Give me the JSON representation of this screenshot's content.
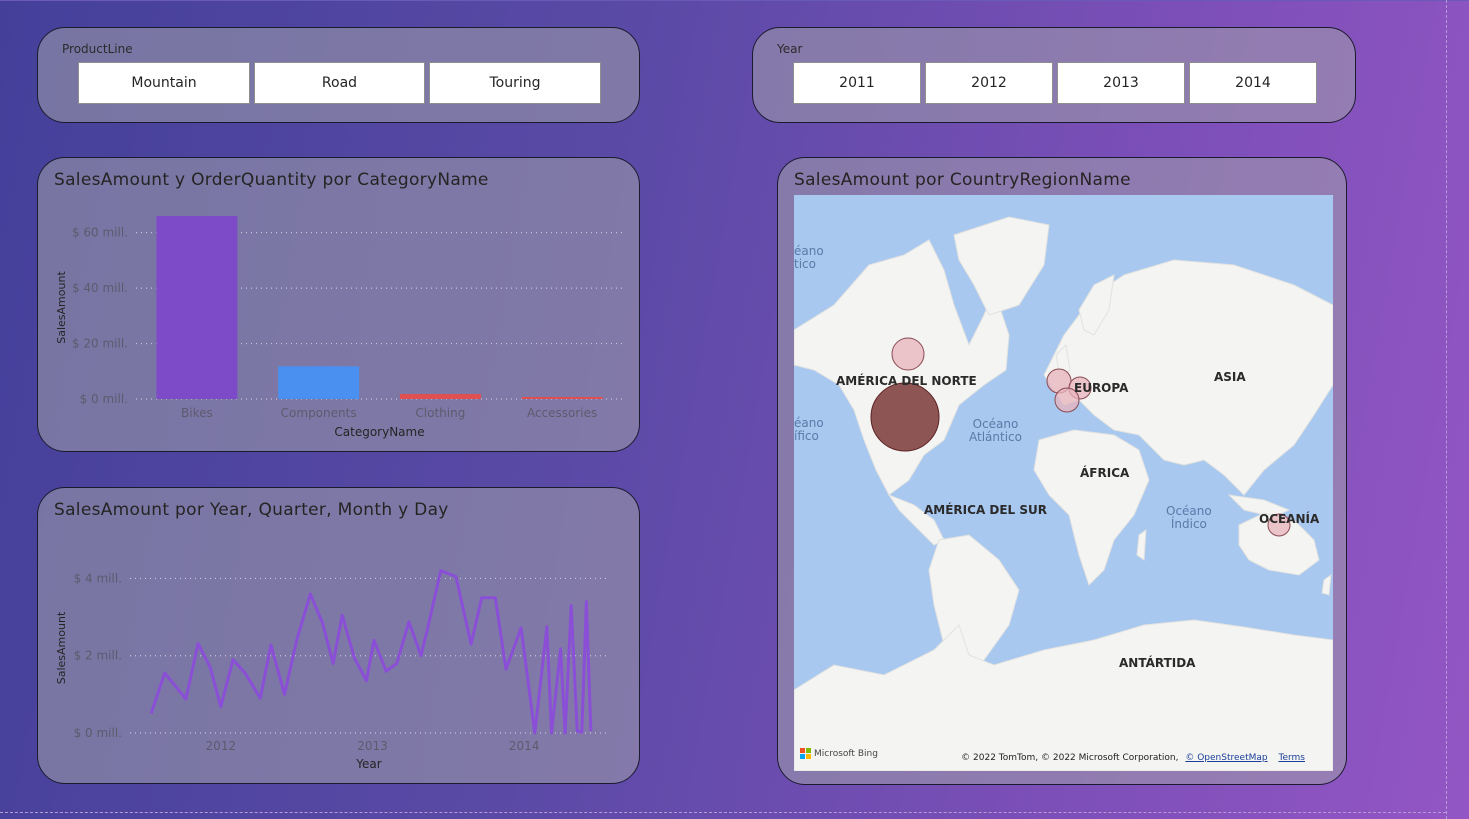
{
  "productline_slicer": {
    "title": "ProductLine",
    "items": [
      {
        "label": "Mountain"
      },
      {
        "label": "Road"
      },
      {
        "label": "Touring"
      }
    ]
  },
  "year_slicer": {
    "title": "Year",
    "items": [
      {
        "label": "2011"
      },
      {
        "label": "2012"
      },
      {
        "label": "2013"
      },
      {
        "label": "2014"
      }
    ]
  },
  "bar_visual": {
    "title": "SalesAmount y OrderQuantity por CategoryName"
  },
  "line_visual": {
    "title": "SalesAmount por Year, Quarter, Month y Day"
  },
  "map_visual": {
    "title": "SalesAmount por CountryRegionName",
    "labels": {
      "north_america": "AMÉRICA DEL NORTE",
      "south_america": "AMÉRICA DEL SUR",
      "europe": "EUROPA",
      "asia": "ASIA",
      "africa": "ÁFRICA",
      "oceania": "OCEANÍA",
      "antarctica": "ANTÁRTIDA",
      "atlantic_1": "Océano",
      "atlantic_2": "Atlántico",
      "indian_1": "Océano",
      "indian_2": "Índico",
      "edge_pacific_n_1": "éano",
      "edge_pacific_n_2": "tico",
      "edge_pacific_s_1": "éano",
      "edge_pacific_s_2": "ífico"
    },
    "logo": "Microsoft Bing",
    "copyright": "© 2022 TomTom, © 2022 Microsoft Corporation,",
    "osm_link": "© OpenStreetMap",
    "terms_link": "Terms",
    "bubble_color": "#7a3a3a",
    "small_bubble_color": "#e8b4bc"
  },
  "colors": {
    "bikes": "#7e4bc8",
    "components": "#4a90f0",
    "clothing": "#e05050",
    "accessories": "#e05050",
    "line": "#8a4fd6"
  },
  "chart_data": [
    {
      "type": "bar",
      "title": "SalesAmount y OrderQuantity por CategoryName",
      "xlabel": "CategoryName",
      "ylabel": "SalesAmount",
      "categories": [
        "Bikes",
        "Components",
        "Clothing",
        "Accessories"
      ],
      "values": [
        66,
        11.8,
        1.8,
        0.7
      ],
      "ylim": [
        0,
        66
      ],
      "yticks": [
        0,
        20,
        40,
        60
      ],
      "ytick_labels": [
        "$ 0 mill.",
        "$ 20 mill.",
        "$ 40 mill.",
        "$ 60 mill."
      ],
      "grid": true
    },
    {
      "type": "line",
      "title": "SalesAmount por Year, Quarter, Month y Day",
      "xlabel": "Year",
      "ylabel": "SalesAmount",
      "x_range": [
        2011.5,
        2014.5
      ],
      "xticks": [
        2012,
        2013,
        2014
      ],
      "xtick_labels": [
        "2012",
        "2013",
        "2014"
      ],
      "ylim": [
        0,
        4.4
      ],
      "yticks": [
        0,
        2,
        4
      ],
      "ytick_labels": [
        "$ 0 mill.",
        "$ 2 mill.",
        "$ 4 mill."
      ],
      "grid": true,
      "x": [
        2011.54,
        2011.63,
        2011.77,
        2011.85,
        2011.93,
        2012.0,
        2012.08,
        2012.16,
        2012.26,
        2012.33,
        2012.42,
        2012.5,
        2012.59,
        2012.67,
        2012.74,
        2012.8,
        2012.88,
        2012.96,
        2013.01,
        2013.09,
        2013.16,
        2013.24,
        2013.32,
        2013.36,
        2013.45,
        2013.55,
        2013.65,
        2013.72,
        2013.81,
        2013.88,
        2013.98,
        2014.07,
        2014.15,
        2014.18,
        2014.24,
        2014.27,
        2014.31,
        2014.35,
        2014.38,
        2014.41,
        2014.44
      ],
      "values": [
        0.5,
        1.55,
        0.88,
        2.32,
        1.7,
        0.68,
        1.9,
        1.55,
        0.9,
        2.28,
        1.0,
        2.4,
        3.6,
        2.85,
        1.8,
        3.05,
        1.95,
        1.35,
        2.4,
        1.6,
        1.8,
        2.88,
        2.0,
        2.65,
        4.2,
        4.05,
        2.3,
        3.5,
        3.5,
        1.65,
        2.72,
        0.0,
        2.75,
        0.0,
        2.18,
        0.0,
        3.3,
        0.05,
        0.02,
        3.4,
        0.05
      ]
    }
  ]
}
